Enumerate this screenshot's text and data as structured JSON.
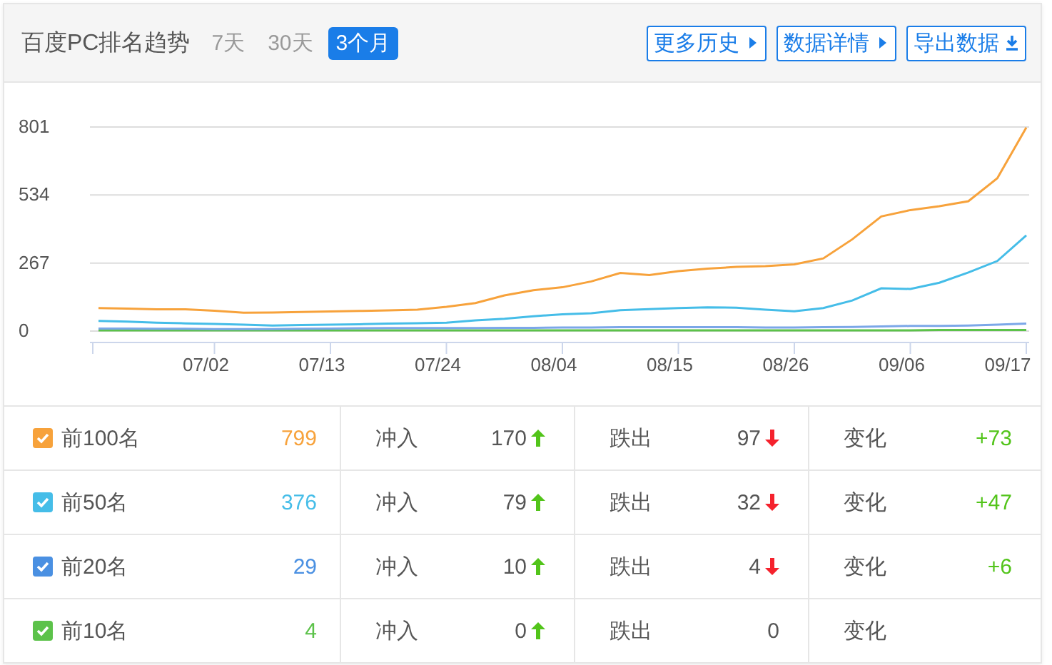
{
  "header": {
    "title": "百度PC排名趋势",
    "tabs": [
      {
        "label": "7天",
        "selected": false
      },
      {
        "label": "30天",
        "selected": false
      },
      {
        "label": "3个月",
        "selected": true
      }
    ],
    "buttons": [
      {
        "label": "更多历史",
        "kind": "more"
      },
      {
        "label": "数据详情",
        "kind": "more"
      },
      {
        "label": "导出数据",
        "kind": "download"
      }
    ]
  },
  "chart_data": {
    "type": "line",
    "ylim": [
      0,
      801
    ],
    "yticks": [
      0,
      267,
      534,
      801
    ],
    "categories": [
      null,
      null,
      null,
      null,
      "07/02",
      null,
      null,
      null,
      "07/13",
      null,
      null,
      null,
      "07/24",
      null,
      null,
      null,
      "08/04",
      null,
      null,
      null,
      "08/15",
      null,
      null,
      null,
      "08/26",
      null,
      null,
      null,
      "09/06",
      null,
      null,
      null,
      "09/17"
    ],
    "series": [
      {
        "name": "前100名",
        "color": "#f7a23b",
        "values": [
          90,
          88,
          85,
          85,
          80,
          72,
          73,
          75,
          77,
          79,
          81,
          84,
          95,
          110,
          140,
          160,
          172,
          195,
          228,
          220,
          235,
          245,
          252,
          255,
          262,
          285,
          360,
          450,
          475,
          490,
          510,
          600,
          799
        ]
      },
      {
        "name": "前50名",
        "color": "#45bde8",
        "values": [
          40,
          37,
          33,
          30,
          28,
          25,
          22,
          24,
          25,
          27,
          29,
          31,
          33,
          42,
          48,
          58,
          66,
          70,
          82,
          86,
          90,
          93,
          92,
          84,
          78,
          90,
          120,
          168,
          165,
          190,
          230,
          275,
          376
        ]
      },
      {
        "name": "前20名",
        "color": "#7ba7e8",
        "values": [
          10,
          10,
          9,
          9,
          8,
          8,
          8,
          9,
          10,
          11,
          12,
          12,
          12,
          12,
          13,
          13,
          14,
          14,
          15,
          15,
          15,
          15,
          15,
          14,
          14,
          15,
          16,
          18,
          20,
          20,
          22,
          25,
          29
        ]
      },
      {
        "name": "前10名",
        "color": "#5cc24a",
        "values": [
          3,
          3,
          3,
          3,
          3,
          3,
          3,
          3,
          3,
          3,
          3,
          3,
          3,
          3,
          3,
          3,
          3,
          3,
          3,
          3,
          3,
          3,
          3,
          3,
          3,
          3,
          3,
          3,
          3,
          4,
          4,
          4,
          4
        ]
      }
    ]
  },
  "rows": [
    {
      "color": "#f7a23b",
      "checked": true,
      "total": "799",
      "in_label": "冲入",
      "in": "170",
      "out_label": "跌出",
      "out": "97",
      "change_label": "变化",
      "change": "+73"
    },
    {
      "color": "#45bde8",
      "checked": true,
      "total": "376",
      "in_label": "冲入",
      "in": "79",
      "out_label": "跌出",
      "out": "32",
      "change_label": "变化",
      "change": "+47"
    },
    {
      "color": "#4a90e2",
      "checked": true,
      "total": "29",
      "in_label": "冲入",
      "in": "10",
      "out_label": "跌出",
      "out": "4",
      "change_label": "变化",
      "change": "+6"
    },
    {
      "color": "#5cc24a",
      "checked": true,
      "total": "4",
      "in_label": "冲入",
      "in": "0",
      "out_label": "跌出",
      "out": "0",
      "change_label": "变化"
    }
  ]
}
